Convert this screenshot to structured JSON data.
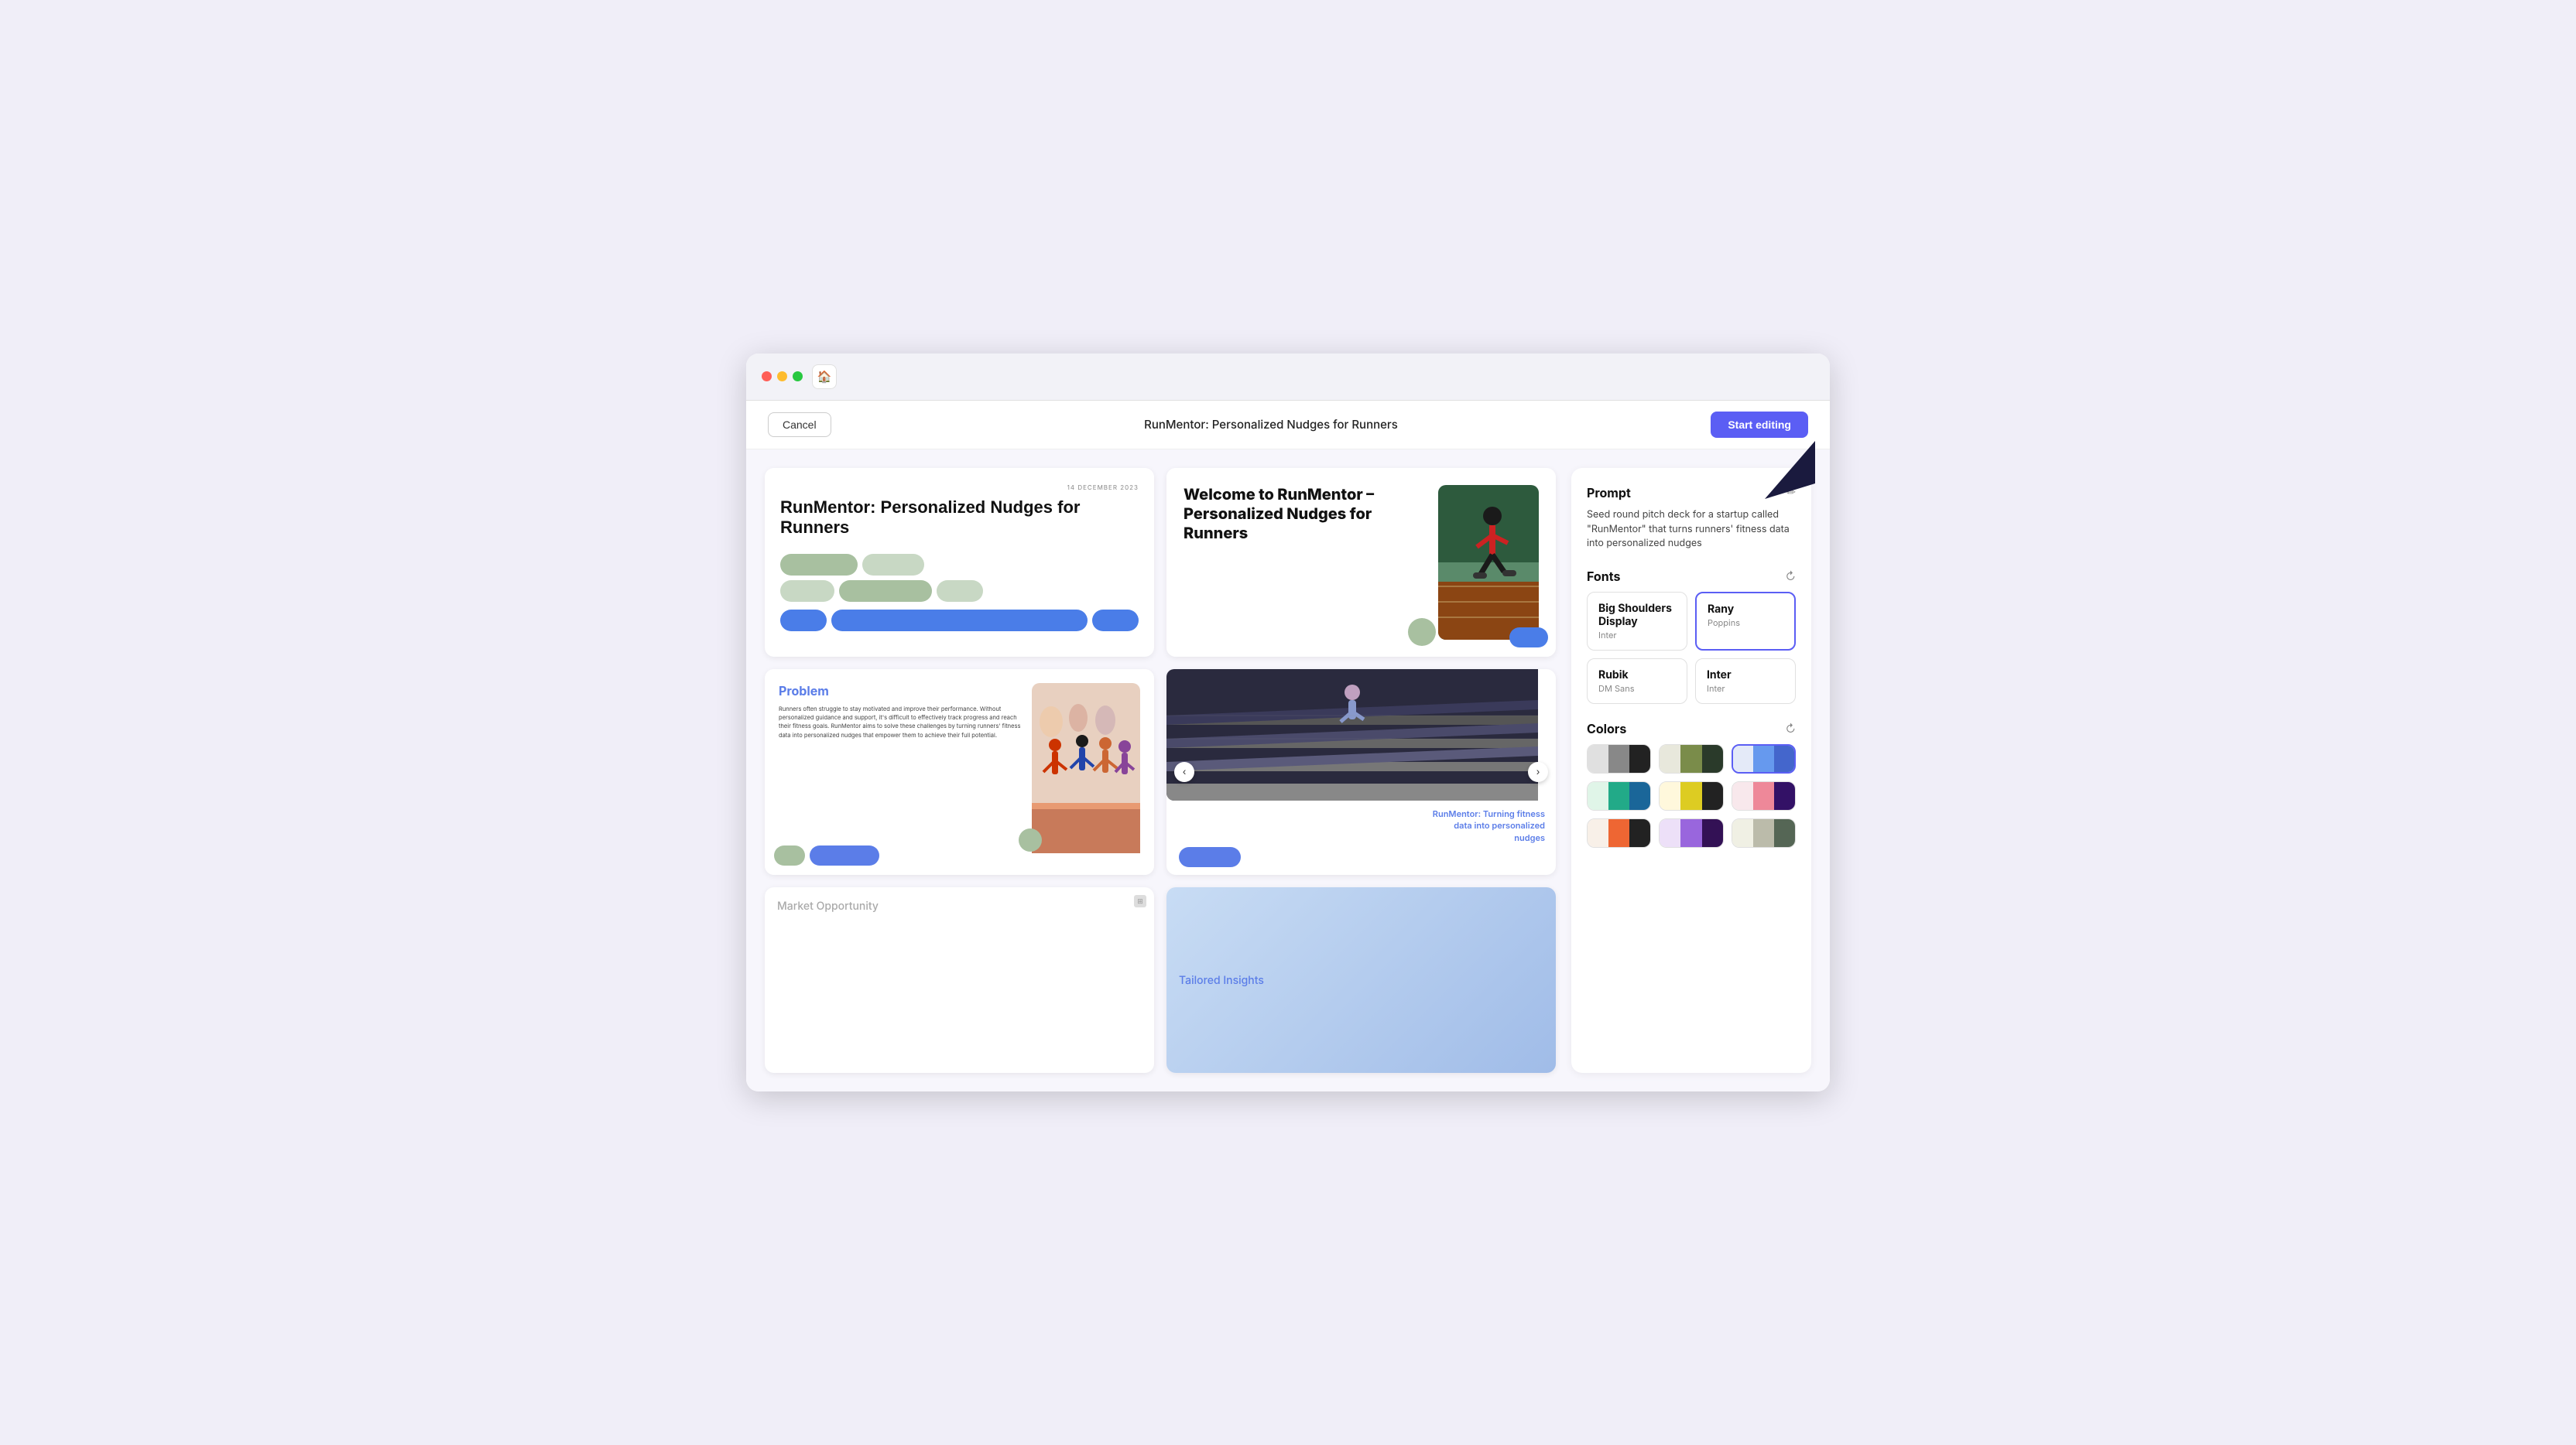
{
  "browser": {
    "home_icon": "🏠"
  },
  "topbar": {
    "cancel_label": "Cancel",
    "page_title": "RunMentor: Personalized Nudges for Runners",
    "start_editing_label": "Start editing"
  },
  "slides": {
    "slide1": {
      "date": "14 DECEMBER 2023",
      "title": "RunMentor: Personalized Nudges for Runners"
    },
    "slide2": {
      "title": "Welcome to RunMentor – Personalized Nudges for Runners"
    },
    "slide3": {
      "problem_title": "Problem",
      "body_text": "Runners often struggle to stay motivated and improve their performance. Without personalized guidance and support, it's difficult to effectively track progress and reach their fitness goals. RunMentor aims to solve these challenges by turning runners' fitness data into personalized nudges that empower them to achieve their full potential."
    },
    "slide4": {
      "caption": "RunMentor: Turning fitness data into personalized nudges"
    },
    "slide5": {
      "title": "Market Opportunity"
    },
    "slide6": {
      "title": "Tailored Insights"
    }
  },
  "right_panel": {
    "prompt": {
      "section_title": "Prompt",
      "body_text": "Seed round pitch deck for a startup called \"RunMentor\" that turns runners' fitness data into personalized nudges",
      "edit_icon": "✏️"
    },
    "fonts": {
      "section_title": "Fonts",
      "refresh_icon": "↻",
      "options": [
        {
          "id": "font1",
          "primary": "Big Shoulders Display",
          "secondary": "Inter",
          "selected": false
        },
        {
          "id": "font2",
          "primary": "Rany",
          "secondary": "Poppins",
          "selected": true
        },
        {
          "id": "font3",
          "primary": "Rubik",
          "secondary": "DM Sans",
          "selected": false
        },
        {
          "id": "font4",
          "primary": "Inter",
          "secondary": "Inter",
          "selected": false
        }
      ]
    },
    "colors": {
      "section_title": "Colors",
      "refresh_icon": "↻",
      "palettes": [
        {
          "id": "pal1",
          "selected": false,
          "swatches": [
            "#e8e8e8",
            "#888888",
            "#222222"
          ]
        },
        {
          "id": "pal2",
          "selected": false,
          "swatches": [
            "#e8e8e0",
            "#7a8c4a",
            "#2a3a2a"
          ]
        },
        {
          "id": "pal3",
          "selected": true,
          "swatches": [
            "#e8eef8",
            "#6699ee",
            "#4466cc"
          ]
        },
        {
          "id": "pal4",
          "selected": false,
          "swatches": [
            "#e0f5e8",
            "#22aa88",
            "#1a6699"
          ]
        },
        {
          "id": "pal5",
          "selected": false,
          "swatches": [
            "#fff8e0",
            "#ddcc22",
            "#222222"
          ]
        },
        {
          "id": "pal6",
          "selected": false,
          "swatches": [
            "#f8e8e8",
            "#ee8899",
            "#331166"
          ]
        },
        {
          "id": "pal7",
          "selected": false,
          "swatches": [
            "#f8f8f0",
            "#ee6633",
            "#222222"
          ]
        },
        {
          "id": "pal8",
          "selected": false,
          "swatches": [
            "#e8e0f8",
            "#9966dd",
            "#331155"
          ]
        },
        {
          "id": "pal9",
          "selected": false,
          "swatches": [
            "#f0f0e8",
            "#bbbbaa",
            "#556655"
          ]
        }
      ]
    }
  }
}
